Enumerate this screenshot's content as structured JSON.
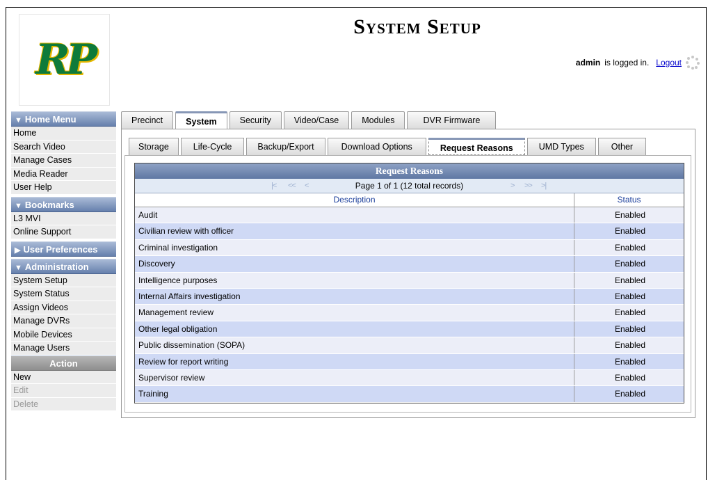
{
  "logo": {
    "text": "RP"
  },
  "header": {
    "title": "System Setup"
  },
  "login": {
    "user": "admin",
    "status": "is logged in.",
    "logout_label": "Logout"
  },
  "sidebar": {
    "home_menu": {
      "title": "Home Menu",
      "items": [
        "Home",
        "Search Video",
        "Manage Cases",
        "Media Reader",
        "User Help"
      ]
    },
    "bookmarks": {
      "title": "Bookmarks",
      "items": [
        "L3 MVI",
        "Online Support"
      ]
    },
    "user_prefs": {
      "title": "User Preferences"
    },
    "administration": {
      "title": "Administration",
      "items": [
        "System Setup",
        "System Status",
        "Assign Videos",
        "Manage DVRs",
        "Mobile Devices",
        "Manage Users"
      ]
    },
    "action": {
      "title": "Action",
      "items": [
        "New",
        "Edit",
        "Delete"
      ]
    }
  },
  "tabs_main": [
    "Precinct",
    "System",
    "Security",
    "Video/Case",
    "Modules",
    "DVR Firmware"
  ],
  "tabs_sub": [
    "Storage",
    "Life-Cycle",
    "Backup/Export",
    "Download Options",
    "Request Reasons",
    "UMD Types",
    "Other"
  ],
  "grid": {
    "title": "Request Reasons",
    "pager_text": "Page 1 of 1 (12 total records)",
    "columns": [
      "Description",
      "Status"
    ],
    "rows": [
      [
        "Audit",
        "Enabled"
      ],
      [
        "Civilian review with officer",
        "Enabled"
      ],
      [
        "Criminal investigation",
        "Enabled"
      ],
      [
        "Discovery",
        "Enabled"
      ],
      [
        "Intelligence purposes",
        "Enabled"
      ],
      [
        "Internal Affairs investigation",
        "Enabled"
      ],
      [
        "Management review",
        "Enabled"
      ],
      [
        "Other legal obligation",
        "Enabled"
      ],
      [
        "Public dissemination (SOPA)",
        "Enabled"
      ],
      [
        "Review for report writing",
        "Enabled"
      ],
      [
        "Supervisor review",
        "Enabled"
      ],
      [
        "Training",
        "Enabled"
      ]
    ]
  }
}
